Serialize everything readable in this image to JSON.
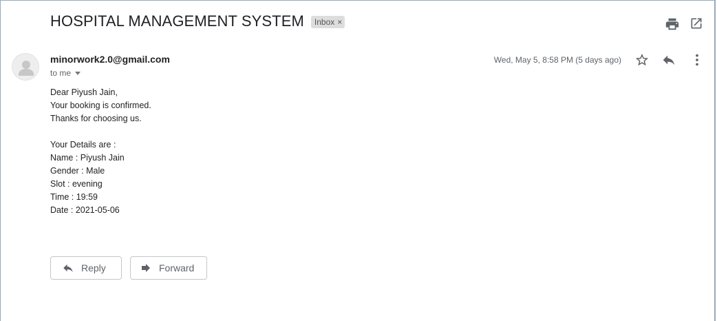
{
  "email": {
    "subject": "HOSPITAL MANAGEMENT SYSTEM",
    "label": "Inbox",
    "label_close": "×",
    "sender": "minorwork2.0@gmail.com",
    "recipient": "to me",
    "date": "Wed, May 5, 8:58 PM (5 days ago)",
    "body_lines": [
      "Dear Piyush Jain,",
      "Your booking is confirmed.",
      "Thanks for choosing us.",
      "",
      "Your Details are :",
      "Name : Piyush Jain",
      "Gender : Male",
      "Slot : evening",
      "Time : 19:59",
      "Date : 2021-05-06"
    ]
  },
  "actions": {
    "reply_label": "Reply",
    "forward_label": "Forward"
  },
  "icons": {
    "print": "print-icon",
    "open_new_window": "open-in-new-window-icon",
    "star": "star-icon",
    "reply": "reply-icon",
    "more": "more-vert-icon",
    "avatar": "default-avatar-icon"
  },
  "colors": {
    "icon_gray": "#5f6368",
    "chip_bg": "#dddddd",
    "frame_border": "#9aa8b6"
  }
}
